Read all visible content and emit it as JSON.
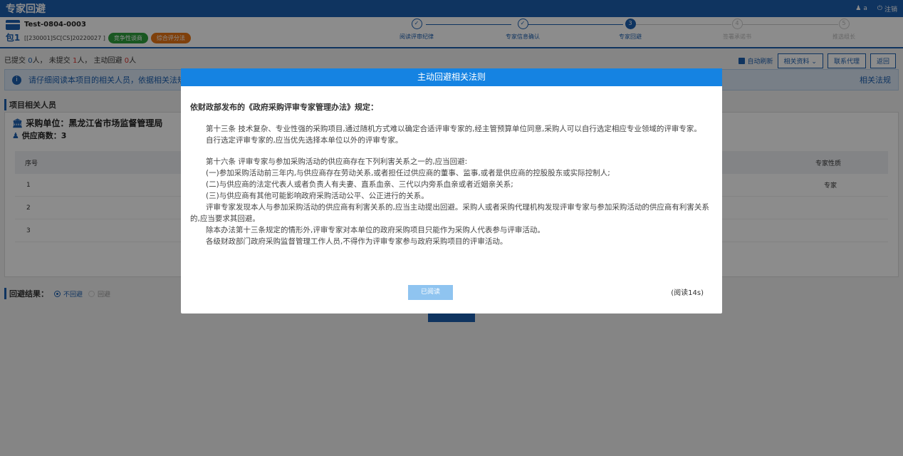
{
  "app": {
    "title": "专家回避",
    "user": "a",
    "logout": "注销"
  },
  "header": {
    "package_label": "包1",
    "project_name": "Test-0804-0003",
    "project_code": "[[230001]SC[CS]20220027 ]",
    "badge_green": "竞争性谈商",
    "badge_orange": "综合评分法"
  },
  "steps": [
    {
      "label": "阅读评审纪律",
      "state": "done",
      "num": ""
    },
    {
      "label": "专家信息确认",
      "state": "done",
      "num": ""
    },
    {
      "label": "专家回避",
      "state": "active",
      "num": "3"
    },
    {
      "label": "签署承诺书",
      "state": "todo",
      "num": "4"
    },
    {
      "label": "推选组长",
      "state": "todo",
      "num": "5"
    }
  ],
  "status": {
    "submitted_label": "已提交",
    "submitted_count": "0",
    "unsubmitted_label": "未提交",
    "unsubmitted_count": "1",
    "avoid_label": "主动回避",
    "avoid_count": "0",
    "unit": "人"
  },
  "toolbar": {
    "auto_refresh": "自动刷新",
    "related_docs": "相关资料",
    "contact_agent": "联系代理",
    "back": "返回"
  },
  "info_bar": {
    "text": "请仔细阅读本项目的相关人员，依据相关法规",
    "law_link": "相关法规"
  },
  "section": {
    "title": "项目相关人员",
    "purchaser": "采购单位：黑龙江省市场监督管理局",
    "supplier_count": "供应商数：3"
  },
  "table": {
    "headers": [
      "序号",
      "专家性质"
    ],
    "rows": [
      {
        "no": "1",
        "nature": "专家"
      },
      {
        "no": "2",
        "nature": ""
      },
      {
        "no": "3",
        "nature": ""
      }
    ]
  },
  "result": {
    "label": "回避结果：",
    "option1": "不回避",
    "option2": "回避"
  },
  "modal": {
    "title": "主动回避相关法则",
    "intro": "依财政部发布的《政府采购评审专家管理办法》规定：",
    "para13_1": "第十三条 技术复杂、专业性强的采购项目,通过随机方式难以确定合适评审专家的,经主管预算单位同意,采购人可以自行选定相应专业领域的评审专家。",
    "para13_2": "自行选定评审专家的,应当优先选择本单位以外的评审专家。",
    "para16": "第十六条 评审专家与参加采购活动的供应商存在下列利害关系之一的,应当回避:",
    "item1": "(一)参加采购活动前三年内,与供应商存在劳动关系,或者担任过供应商的董事、监事,或者是供应商的控股股东或实际控制人;",
    "item2": "(二)与供应商的法定代表人或者负责人有夫妻、直系血亲、三代以内旁系血亲或者近姻亲关系;",
    "item3": "(三)与供应商有其他可能影响政府采购活动公平、公正进行的关系。",
    "para_found": "评审专家发现本人与参加采购活动的供应商有利害关系的,应当主动提出回避。采购人或者采购代理机构发现评审专家与参加采购活动的供应商有利害关系的,应当要求其回避。",
    "para_except": "除本办法第十三条规定的情形外,评审专家对本单位的政府采购项目只能作为采购人代表参与评审活动。",
    "para_staff": "各级财政部门政府采购监督管理工作人员,不得作为评审专家参与政府采购项目的评审活动。",
    "read_button": "已阅读",
    "countdown": "(阅读14s)"
  }
}
